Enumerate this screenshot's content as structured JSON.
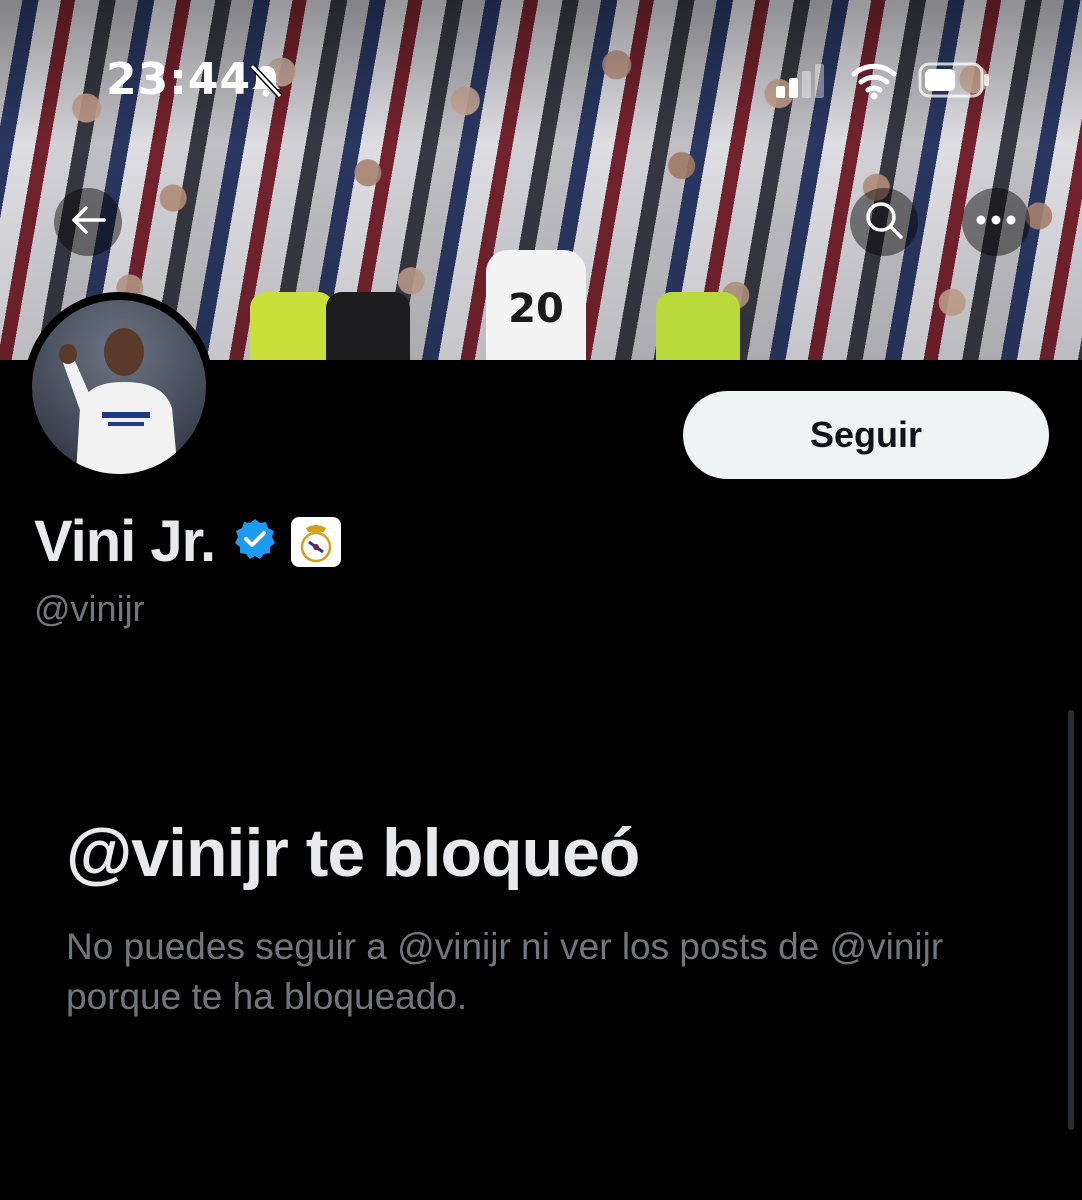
{
  "status_bar": {
    "time": "23:44",
    "icons": [
      "bell-slash-icon",
      "signal-icon",
      "wifi-icon",
      "battery-icon"
    ]
  },
  "header": {
    "back_icon": "arrow-left-icon",
    "search_icon": "search-icon",
    "more_icon": "ellipsis-icon"
  },
  "banner": {
    "jersey_number": "20"
  },
  "profile": {
    "display_name": "Vini Jr.",
    "handle": "@vinijr",
    "verified_icon": "verified-badge-icon",
    "affiliate_icon": "real-madrid-crest-icon",
    "follow_label": "Seguir"
  },
  "blocked": {
    "title": "@vinijr te bloqueó",
    "description": "No puedes seguir a @vinijr ni ver los posts de @vinijr porque te ha bloqueado."
  },
  "colors": {
    "background": "#000000",
    "primary_text": "#e7e9ea",
    "secondary_text": "#71767b",
    "verified_blue": "#1d9bf0",
    "button_bg": "#eff3f4"
  }
}
